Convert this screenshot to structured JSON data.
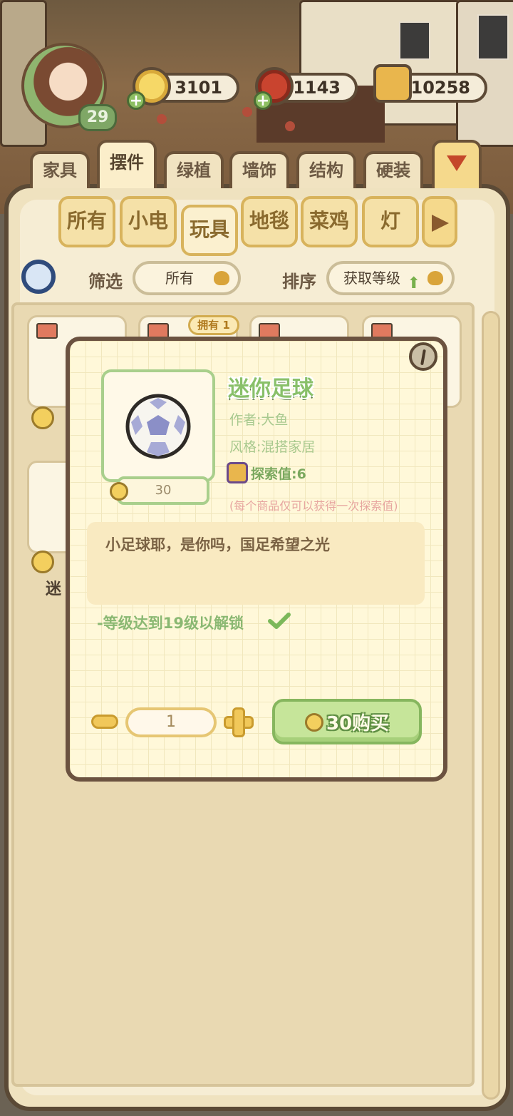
{
  "hud": {
    "level": "29",
    "coins": "3101",
    "food": "1143",
    "explore": "10258"
  },
  "category_tabs": [
    "家具",
    "摆件",
    "绿植",
    "墙饰",
    "结构",
    "硬装"
  ],
  "sub_tabs": [
    "所有",
    "小电",
    "玩具",
    "地毯",
    "菜鸡",
    "灯"
  ],
  "filter": {
    "filter_label": "筛选",
    "filter_value": "所有",
    "sort_label": "排序",
    "sort_value": "获取等级"
  },
  "grid": {
    "owned_badge": "拥有 1",
    "partial_label": "迷"
  },
  "modal": {
    "item_name": "迷你足球",
    "author": "作者:大鱼",
    "style": "风格:混搭家居",
    "explore_value": "探索值:6",
    "explore_note": "(每个商品仅可以获得一次探索值)",
    "price": "30",
    "description": "小足球耶，是你吗，国足希望之光",
    "unlock_condition": "-等级达到19级以解锁",
    "quantity": "1",
    "buy_label": "30购买"
  },
  "colors": {
    "accent_green": "#89c06a",
    "coin_gold": "#f3cf5e",
    "panel_border": "#5b4a36"
  }
}
